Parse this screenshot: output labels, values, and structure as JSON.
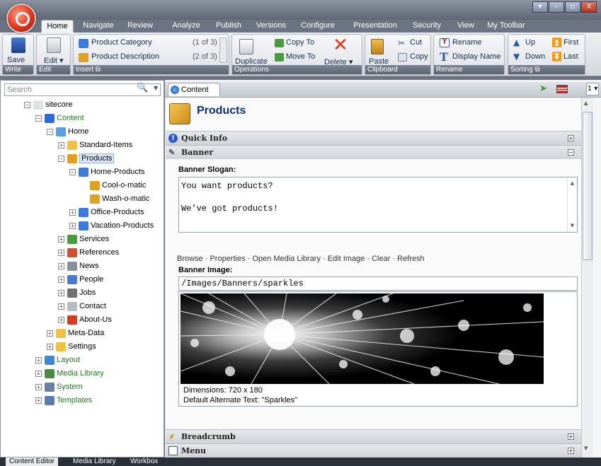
{
  "tabs": [
    "Home",
    "Navigate",
    "Review",
    "Analyze",
    "Publish",
    "Versions",
    "Configure",
    "Presentation",
    "Security",
    "View",
    "My Toolbar"
  ],
  "window_buttons": [
    "▾",
    "–",
    "▫",
    "X"
  ],
  "ribbon": {
    "write": {
      "label": "Write",
      "save": "Save"
    },
    "edit": {
      "label": "Edit",
      "edit": "Edit ▾"
    },
    "insert": {
      "label": "Insert ⧉",
      "items": [
        {
          "name": "Product Category",
          "count": "(1 of 3)"
        },
        {
          "name": "Product Description",
          "count": "(2 of 3)"
        }
      ]
    },
    "operations": {
      "label": "Operations",
      "duplicate": "Duplicate",
      "copy_to": "Copy To",
      "move_to": "Move To",
      "delete": "Delete ▾"
    },
    "clipboard": {
      "label": "Clipboard",
      "paste": "Paste",
      "cut": "Cut",
      "copy": "Copy"
    },
    "rename": {
      "label": "Rename",
      "rename": "Rename",
      "display_name": "Display Name"
    },
    "sorting": {
      "label": "Sorting ⧉",
      "up": "Up",
      "down": "Down",
      "first": "First",
      "last": "Last"
    }
  },
  "search": {
    "placeholder": "Search"
  },
  "tree": [
    {
      "label": "sitecore",
      "level": 0,
      "pm": "⊟",
      "green": false,
      "icon": "#dfe3e8"
    },
    {
      "label": "Content",
      "level": 1,
      "pm": "⊟",
      "green": true,
      "icon": "#2f6bd8"
    },
    {
      "label": "Home",
      "level": 2,
      "pm": "⊟",
      "green": false,
      "icon": "#5a9ee0"
    },
    {
      "label": "Standard-Items",
      "level": 3,
      "pm": "⊞",
      "green": false,
      "icon": "#f0c040"
    },
    {
      "label": "Products",
      "level": 3,
      "pm": "⊟",
      "green": false,
      "icon": "#e0a020",
      "selected": true
    },
    {
      "label": "Home-Products",
      "level": 4,
      "pm": "⊟",
      "green": false,
      "icon": "#3a7be0"
    },
    {
      "label": "Cool-o-matic",
      "level": 5,
      "pm": "",
      "green": false,
      "icon": "#e0a020"
    },
    {
      "label": "Wash-o-matic",
      "level": 5,
      "pm": "",
      "green": false,
      "icon": "#e0a020"
    },
    {
      "label": "Office-Products",
      "level": 4,
      "pm": "⊞",
      "green": false,
      "icon": "#3a7be0"
    },
    {
      "label": "Vacation-Products",
      "level": 4,
      "pm": "⊞",
      "green": false,
      "icon": "#3a7be0"
    },
    {
      "label": "Services",
      "level": 3,
      "pm": "⊞",
      "green": false,
      "icon": "#4a9a40"
    },
    {
      "label": "References",
      "level": 3,
      "pm": "⊞",
      "green": false,
      "icon": "#d05030"
    },
    {
      "label": "News",
      "level": 3,
      "pm": "⊞",
      "green": false,
      "icon": "#8a8f98"
    },
    {
      "label": "People",
      "level": 3,
      "pm": "⊞",
      "green": false,
      "icon": "#4a7ad0"
    },
    {
      "label": "Jobs",
      "level": 3,
      "pm": "⊞",
      "green": false,
      "icon": "#707070"
    },
    {
      "label": "Contact",
      "level": 3,
      "pm": "⊞",
      "green": false,
      "icon": "#b8bcc4"
    },
    {
      "label": "About-Us",
      "level": 3,
      "pm": "⊞",
      "green": false,
      "icon": "#d04020"
    },
    {
      "label": "Meta-Data",
      "level": 2,
      "pm": "⊞",
      "green": false,
      "icon": "#f0c040"
    },
    {
      "label": "Settings",
      "level": 2,
      "pm": "⊞",
      "green": false,
      "icon": "#f0c040"
    },
    {
      "label": "Layout",
      "level": 1,
      "pm": "⊞",
      "green": true,
      "icon": "#3a8ad8"
    },
    {
      "label": "Media Library",
      "level": 1,
      "pm": "⊞",
      "green": true,
      "icon": "#4a8a40"
    },
    {
      "label": "System",
      "level": 1,
      "pm": "⊞",
      "green": true,
      "icon": "#6a80a0"
    },
    {
      "label": "Templates",
      "level": 1,
      "pm": "⊞",
      "green": true,
      "icon": "#5a7ab0"
    }
  ],
  "content_tab": "Content",
  "content_tab_right": "1 ▾",
  "item_title": "Products",
  "sections": {
    "quick_info": "Quick Info",
    "banner": "Banner",
    "breadcrumb": "Breadcrumb",
    "menu": "Menu"
  },
  "banner": {
    "slogan_label": "Banner Slogan:",
    "slogan_value": "You want products?\n\nWe've got products!",
    "media_links": "Browse · Properties · Open Media Library · Edit Image · Clear · Refresh",
    "image_label": "Banner Image:",
    "image_path": "/Images/Banners/sparkles",
    "dimensions": "Dimensions: 720 x 180",
    "alt_text": "Default Alternate Text: \"Sparkles\""
  },
  "bottom_tabs": [
    "Content Editor",
    "Media Library",
    "Workbox"
  ]
}
